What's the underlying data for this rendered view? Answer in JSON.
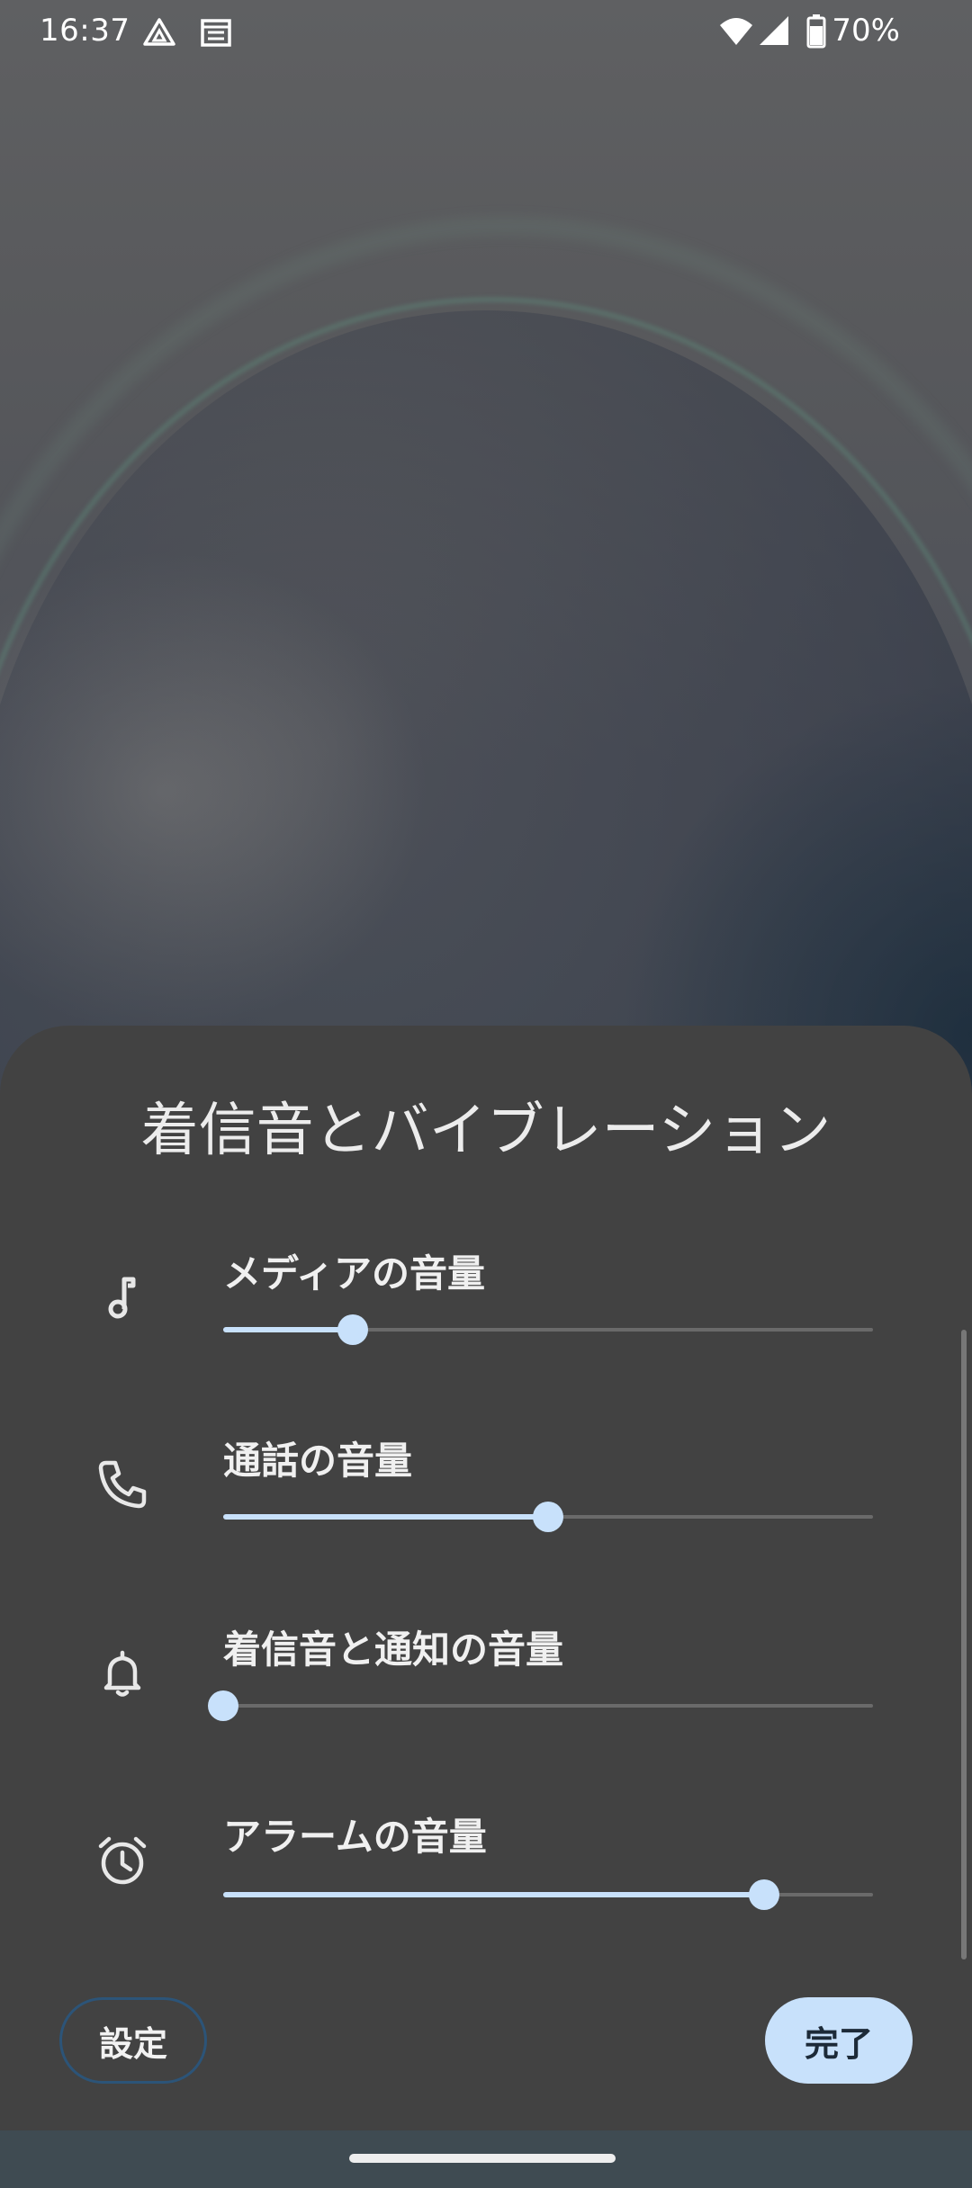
{
  "status_bar": {
    "time": "16:37",
    "battery_percent": "70%",
    "icons": [
      "drive-icon",
      "calendar-icon",
      "wifi-icon",
      "signal-icon",
      "battery-icon"
    ]
  },
  "sheet": {
    "title": "着信音とバイブレーション",
    "rows": [
      {
        "label": "メディアの音量",
        "icon": "music-note-icon",
        "level": 0.2
      },
      {
        "label": "通話の音量",
        "icon": "phone-icon",
        "level": 0.5
      },
      {
        "label": "着信音と通知の音量",
        "icon": "bell-icon",
        "level": 0.0
      },
      {
        "label": "アラームの音量",
        "icon": "alarm-clock-icon",
        "level": 0.833
      }
    ],
    "settings_button": "設定",
    "done_button": "完了"
  },
  "colors": {
    "accent": "#c8e1fb",
    "sheet_background": "#424242",
    "settings_outline": "#2c5478"
  }
}
